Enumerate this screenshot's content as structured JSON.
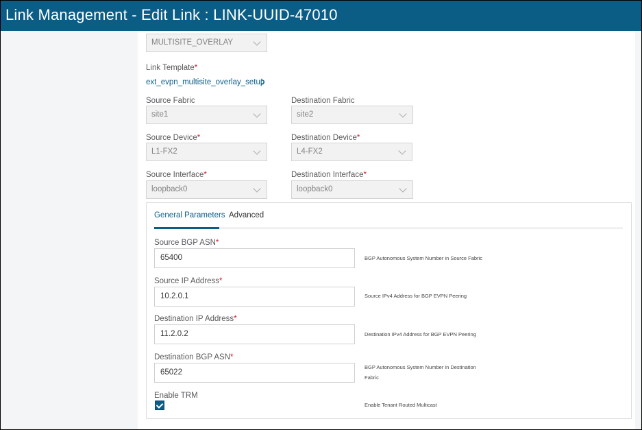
{
  "window": {
    "title": "Link Management - Edit Link : LINK-UUID-47010"
  },
  "link_type": {
    "value": "MULTISITE_OVERLAY"
  },
  "link_template": {
    "label": "Link Template",
    "value": "ext_evpn_multisite_overlay_setup"
  },
  "source_fabric": {
    "label": "Source Fabric",
    "value": "site1"
  },
  "destination_fabric": {
    "label": "Destination Fabric",
    "value": "site2"
  },
  "source_device": {
    "label": "Source Device",
    "value": "L1-FX2"
  },
  "destination_device": {
    "label": "Destination Device",
    "value": "L4-FX2"
  },
  "source_interface": {
    "label": "Source Interface",
    "value": "loopback0"
  },
  "destination_interface": {
    "label": "Destination Interface",
    "value": "loopback0"
  },
  "required_mark": "*",
  "tabs": [
    {
      "label": "General Parameters"
    },
    {
      "label": "Advanced"
    }
  ],
  "params": {
    "source_bgp_asn": {
      "label": "Source BGP ASN",
      "value": "65400",
      "help": "BGP Autonomous System Number in Source Fabric"
    },
    "source_ip": {
      "label": "Source IP Address",
      "value": "10.2.0.1",
      "help": "Source IPv4 Address for BGP EVPN Peering"
    },
    "destination_ip": {
      "label": "Destination IP Address",
      "value": "11.2.0.2",
      "help": "Destination IPv4 Address for BGP EVPN Peering"
    },
    "destination_bgp_asn": {
      "label": "Destination BGP ASN",
      "value": "65022",
      "help_line1": "BGP Autonomous System Number in Destination",
      "help_line2": "Fabric"
    },
    "enable_trm": {
      "label": "Enable TRM",
      "checked": true,
      "help": "Enable Tenant Routed Multicast"
    }
  },
  "colors": {
    "accent": "#0b5d86",
    "required": "#cf2030"
  }
}
